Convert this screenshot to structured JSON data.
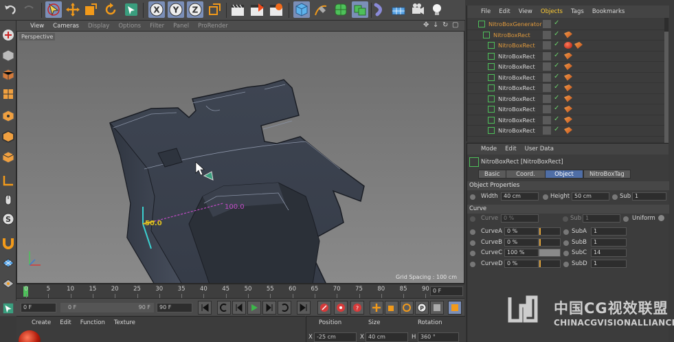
{
  "top_toolbar": {
    "tools": [
      "undo",
      "move-selection",
      "move",
      "scale",
      "rotate",
      "live-selection",
      "axis-x",
      "axis-y",
      "axis-z",
      "coordinate-system",
      "render-view",
      "render-to-picture-viewer",
      "render-settings",
      "cube",
      "pen",
      "subdivision",
      "array",
      "deformer",
      "floor",
      "camera",
      "light"
    ],
    "axis_labels": {
      "x": "X",
      "y": "Y",
      "z": "Z"
    }
  },
  "viewport": {
    "menu": [
      "View",
      "Cameras",
      "Display",
      "Options",
      "Filter",
      "Panel",
      "ProRender"
    ],
    "active_menu": [
      "View",
      "Cameras"
    ],
    "label": "Perspective",
    "grid_spacing": "Grid Spacing : 100 cm",
    "measure_label": "100.0",
    "axis_label": "50.0"
  },
  "timeline": {
    "ticks": [
      "0",
      "5",
      "10",
      "15",
      "20",
      "25",
      "30",
      "35",
      "40",
      "45",
      "50",
      "55",
      "60",
      "65",
      "70",
      "75",
      "80",
      "85",
      "90"
    ],
    "current_frame": "0 F"
  },
  "playback": {
    "start": "0 F",
    "range_start": "0 F",
    "range_end": "90 F",
    "end": "90 F"
  },
  "material_manager": {
    "menu": [
      "Create",
      "Edit",
      "Function",
      "Texture"
    ]
  },
  "coordinates": {
    "headers": [
      "Position",
      "Size",
      "Rotation"
    ],
    "axis_x": "X",
    "axis_h": "H",
    "position_x": "-25 cm",
    "size_x": "40 cm",
    "rotation_h": "360 °"
  },
  "object_manager": {
    "menu": [
      "File",
      "Edit",
      "View",
      "Objects",
      "Tags",
      "Bookmarks"
    ],
    "active_menu": "Objects",
    "rows": [
      {
        "name": "NitroBoxGenerator",
        "level": 0,
        "orange": true
      },
      {
        "name": "NitroBoxRect",
        "level": 1,
        "orange": true
      },
      {
        "name": "NitroBoxRect",
        "level": 2,
        "orange": true,
        "material": true
      },
      {
        "name": "NitroBoxRect",
        "level": 2,
        "orange": false
      },
      {
        "name": "NitroBoxRect",
        "level": 2,
        "orange": false
      },
      {
        "name": "NitroBoxRect",
        "level": 2,
        "orange": false
      },
      {
        "name": "NitroBoxRect",
        "level": 2,
        "orange": false
      },
      {
        "name": "NitroBoxRect",
        "level": 2,
        "orange": false
      },
      {
        "name": "NitroBoxRect",
        "level": 2,
        "orange": false
      },
      {
        "name": "NitroBoxRect",
        "level": 2,
        "orange": false
      },
      {
        "name": "NitroBoxRect",
        "level": 2,
        "orange": false
      }
    ]
  },
  "attribute_manager": {
    "menu": [
      "Mode",
      "Edit",
      "User Data"
    ],
    "title": "NitroBoxRect [NitroBoxRect]",
    "tabs": [
      "Basic",
      "Coord.",
      "Object",
      "NitroBoxTag"
    ],
    "active_tab": "Object",
    "section_object": "Object Properties",
    "width_label": "Width",
    "width_value": "40 cm",
    "height_label": "Height",
    "height_value": "50 cm",
    "sub_label": "Sub",
    "sub_value": "1",
    "section_curve": "Curve",
    "curve_label": "Curve",
    "curve_value": "0 %",
    "curve_sub_label": "Sub",
    "curve_sub_value": "1",
    "uniform_label": "Uniform",
    "curves": [
      {
        "label": "CurveA",
        "value": "0 %",
        "sub_label": "SubA",
        "sub_value": "1",
        "fill": 0.0
      },
      {
        "label": "CurveB",
        "value": "0 %",
        "sub_label": "SubB",
        "sub_value": "1",
        "fill": 0.0
      },
      {
        "label": "CurveC",
        "value": "100 %",
        "sub_label": "SubC",
        "sub_value": "14",
        "fill": 1.0
      },
      {
        "label": "CurveD",
        "value": "0 %",
        "sub_label": "SubD",
        "sub_value": "1",
        "fill": 0.0
      }
    ]
  },
  "watermark": {
    "cn": "中国CG视效联盟",
    "en": "CHINACGVISIONALLIANCE"
  },
  "colors": {
    "accent_blue": "#4f6ea6",
    "highlight_orange": "#e09a3c",
    "green": "#4ec05a",
    "measure_magenta": "#c34bc8"
  }
}
